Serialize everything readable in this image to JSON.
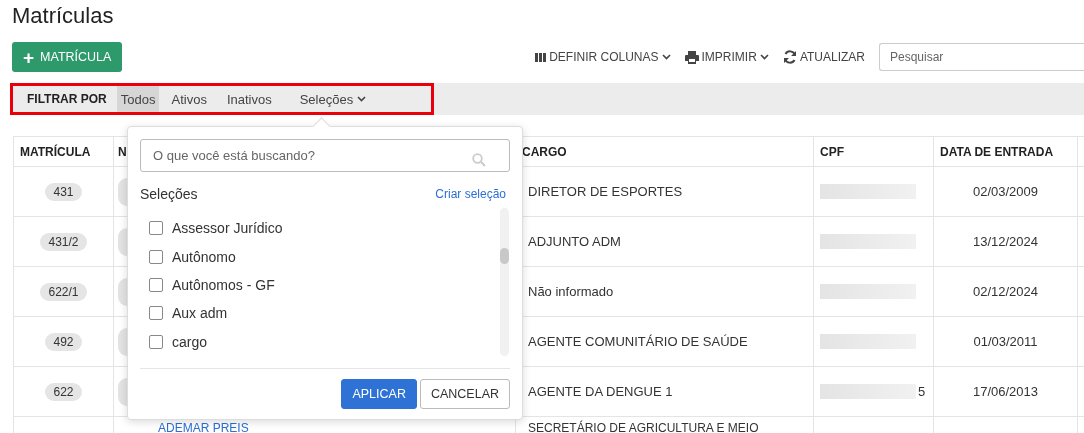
{
  "title": "Matrículas",
  "new_button": {
    "icon": "+",
    "label": "MATRÍCULA"
  },
  "toolbar": [
    {
      "kind": "columns",
      "label": "DEFINIR COLUNAS",
      "dropdown": true
    },
    {
      "kind": "print",
      "label": "IMPRIMIR",
      "dropdown": true
    },
    {
      "kind": "refresh",
      "label": "ATUALIZAR",
      "dropdown": false
    }
  ],
  "search": {
    "placeholder": "Pesquisar"
  },
  "filter": {
    "label": "FILTRAR POR",
    "options": [
      {
        "label": "Todos",
        "selected": true,
        "dropdown": false
      },
      {
        "label": "Ativos",
        "selected": false,
        "dropdown": false
      },
      {
        "label": "Inativos",
        "selected": false,
        "dropdown": false
      },
      {
        "label": "Seleções",
        "selected": false,
        "dropdown": true
      }
    ]
  },
  "table": {
    "columns": [
      "MATRÍCULA",
      "N",
      "CARGO",
      "CPF",
      "DATA DE ENTRADA"
    ],
    "rows": [
      {
        "matricula": "431",
        "cargo": "DIRETOR DE ESPORTES",
        "cpf": "",
        "data": "02/03/2009"
      },
      {
        "matricula": "431/2",
        "cargo": "ADJUNTO ADM",
        "cpf": "",
        "data": "13/12/2024"
      },
      {
        "matricula": "622/1",
        "cargo": "Não informado",
        "cpf": "",
        "data": "02/12/2024"
      },
      {
        "matricula": "492",
        "cargo": "AGENTE COMUNITÁRIO DE SAÚDE",
        "cpf": "",
        "data": "01/03/2011"
      },
      {
        "matricula": "622",
        "cargo": "AGENTE DA DENGUE 1",
        "cpf": "5",
        "data": "17/06/2013"
      },
      {
        "name": "ADEMAR PREIS",
        "cargo": "SECRETÁRIO DE AGRICULTURA E MEIO"
      }
    ]
  },
  "popup": {
    "search": {
      "placeholder": "O que você está buscando?"
    },
    "heading": "Seleções",
    "create_link": "Criar seleção",
    "items": [
      {
        "label": "Assessor Jurídico",
        "checked": false
      },
      {
        "label": "Autônomo",
        "checked": false
      },
      {
        "label": "Autônomos - GF",
        "checked": false
      },
      {
        "label": "Aux adm",
        "checked": false
      },
      {
        "label": "cargo",
        "checked": false
      }
    ],
    "apply": "APLICAR",
    "cancel": "CANCELAR"
  }
}
